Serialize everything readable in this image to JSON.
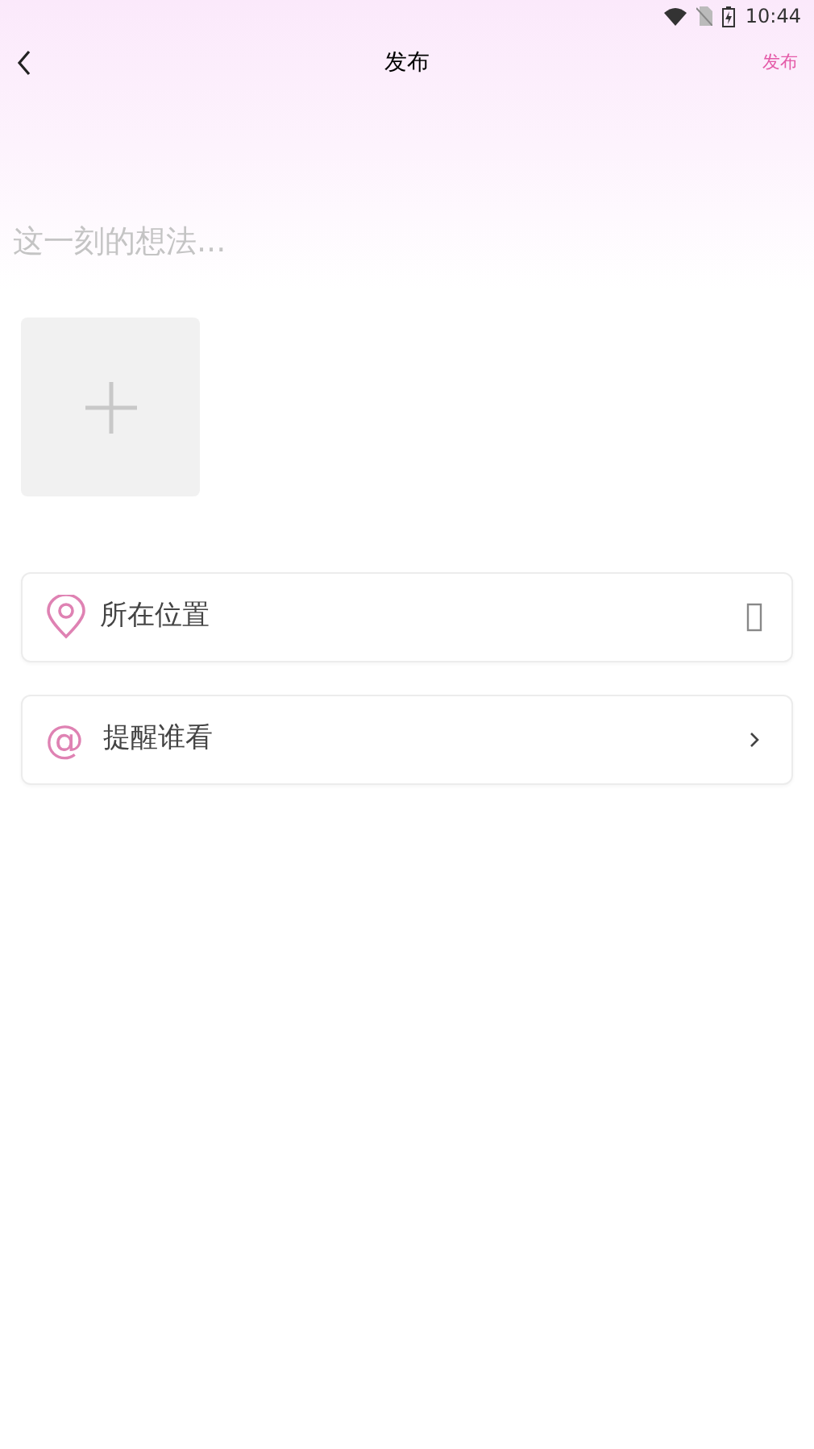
{
  "status_bar": {
    "time": "10:44"
  },
  "header": {
    "title": "发布",
    "action": "发布"
  },
  "post": {
    "placeholder": "这一刻的想法..."
  },
  "options": [
    {
      "kind": "location",
      "label": "所在位置"
    },
    {
      "kind": "mention",
      "icon_char": "@",
      "label": "提醒谁看"
    }
  ]
}
